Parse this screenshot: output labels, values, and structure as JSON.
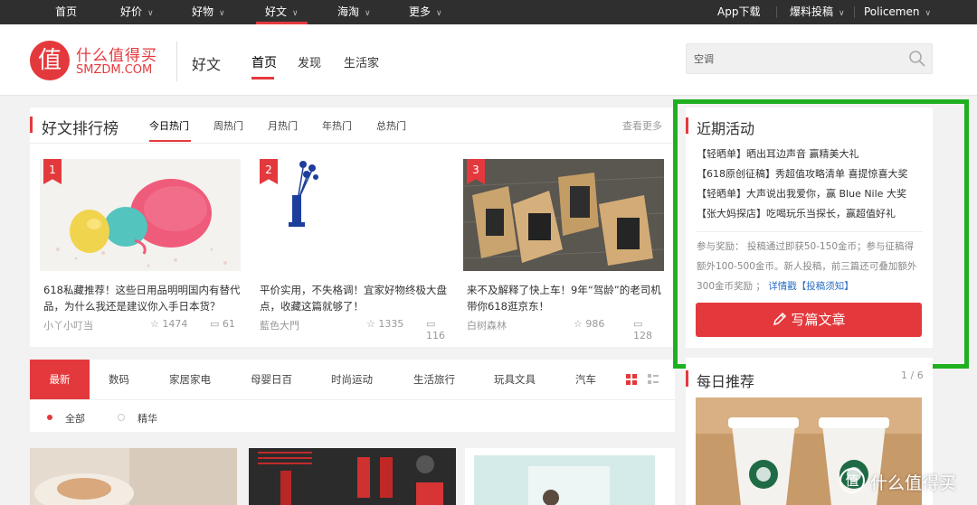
{
  "topnav": {
    "items": [
      "首页",
      "好价",
      "好物",
      "好文",
      "海淘",
      "更多"
    ],
    "right": [
      "App下载",
      "爆料投稿",
      "Policemen"
    ]
  },
  "header": {
    "logo_glyph": "值",
    "logo_cn": "什么值得买",
    "logo_en": "SMZDM.COM",
    "section_title": "好文",
    "nav": [
      "首页",
      "发现",
      "生活家"
    ],
    "search_value": "空调"
  },
  "ranking": {
    "title": "好文排行榜",
    "tabs": [
      "今日热门",
      "周热门",
      "月热门",
      "年热门",
      "总热门"
    ],
    "more": "查看更多",
    "cards": [
      {
        "rank": "1",
        "title": "618私藏推荐！这些日用品明明国内有替代品，为什么我还是建议你入手日本货？",
        "author": "小丫小叮当",
        "likes": "1474",
        "comments": "61"
      },
      {
        "rank": "2",
        "title": "平价实用，不失格调！宜家好物终极大盘点，收藏这篇就够了！",
        "author": "藍色大門",
        "likes": "1335",
        "comments": "116"
      },
      {
        "rank": "3",
        "title": "来不及解释了快上车！9年“驾龄”的老司机带你618逛京东！",
        "author": "白树森林",
        "likes": "986",
        "comments": "128"
      }
    ]
  },
  "categories": {
    "tabs": [
      "最新",
      "数码",
      "家居家电",
      "母婴日百",
      "时尚运动",
      "生活旅行",
      "玩具文具",
      "汽车"
    ],
    "filters": [
      "全部",
      "精华"
    ]
  },
  "activities": {
    "title": "近期活动",
    "links": [
      "【轻晒单】晒出耳边声音 赢精美大礼",
      "【618原创征稿】秀超值攻略清单 喜提惊喜大奖",
      "【轻晒单】大声说出我爱你，赢 Blue Nile 大奖",
      "【张大妈探店】吃喝玩乐当探长，赢超值好礼"
    ],
    "reward_text": "参与奖励： 投稿通过即获50-150金币；参与征稿得额外100-500金币。新人投稿，前三篇还可叠加额外300金币奖励 ；",
    "reward_link": "详情戳【投稿须知】",
    "write_button": "写篇文章"
  },
  "daily": {
    "title": "每日推荐",
    "pager": "1 / 6"
  },
  "watermark": {
    "glyph": "值",
    "text": "什么值得买"
  },
  "colors": {
    "accent": "#e4393c",
    "highlight": "#1fb01f",
    "topbar": "#2f2f2f"
  }
}
